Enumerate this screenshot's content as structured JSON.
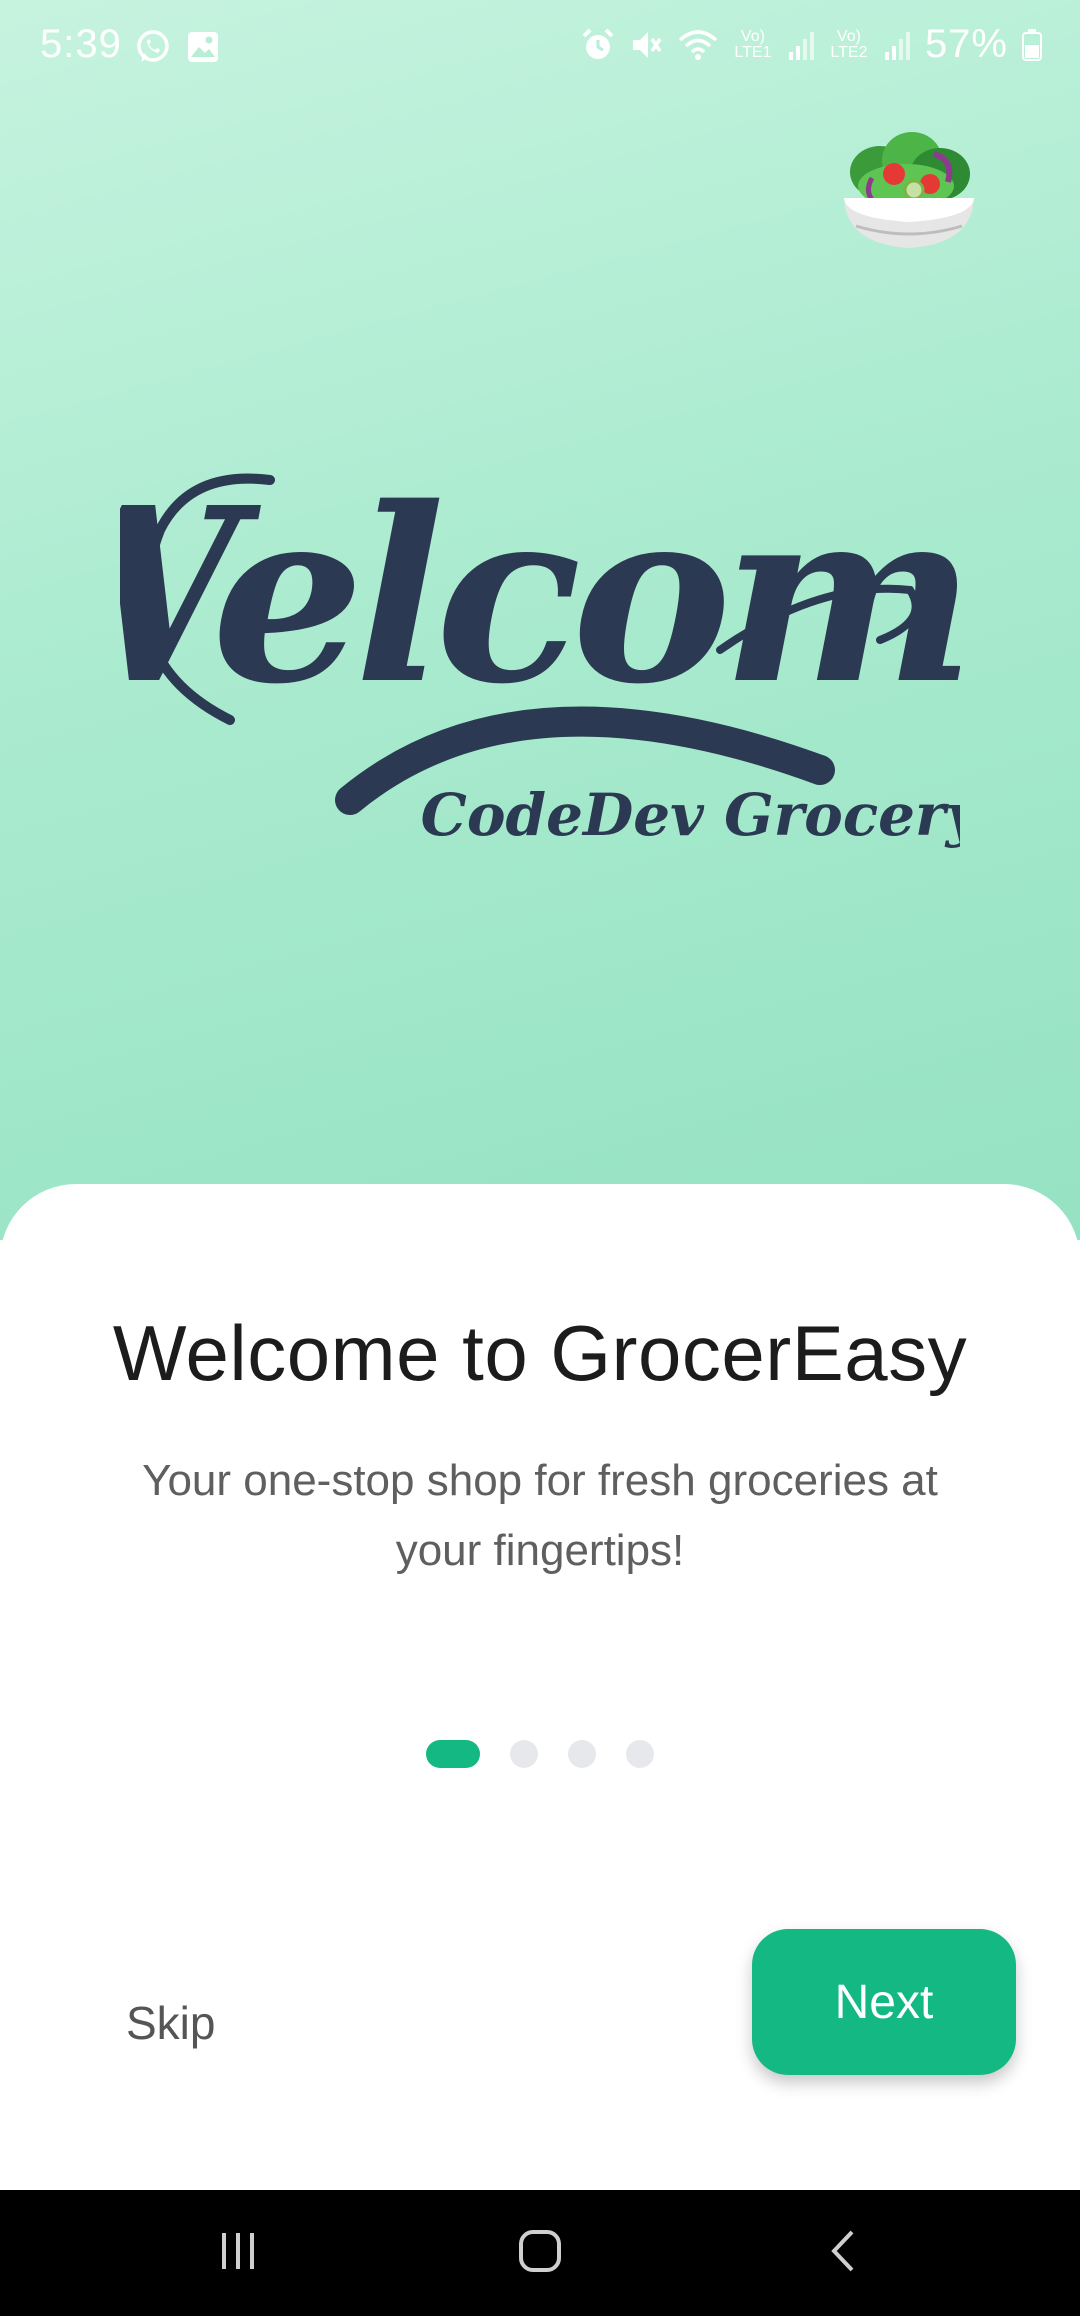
{
  "status_bar": {
    "time": "5:39",
    "battery": "57%",
    "sim1_label": "Vo) LTE1",
    "sim2_label": "Vo) LTE2",
    "icons_left": [
      "whatsapp-icon",
      "gallery-icon"
    ],
    "icons_right": [
      "alarm-icon",
      "mute-icon",
      "wifi-icon",
      "signal-icon",
      "battery-icon"
    ]
  },
  "hero": {
    "logo_word": "Welcome",
    "logo_tagline": "CodeDev Grocery",
    "emoji": "salad-bowl"
  },
  "onboarding": {
    "title": "Welcome to GrocerEasy",
    "subtitle": "Your one-stop shop for fresh groceries at your fingertips!",
    "page_count": 4,
    "active_page": 1
  },
  "actions": {
    "skip_label": "Skip",
    "next_label": "Next"
  },
  "colors": {
    "accent": "#14b883",
    "hero_top": "#c6f3df",
    "hero_bottom": "#95e2c2",
    "logo": "#2b3a52"
  }
}
